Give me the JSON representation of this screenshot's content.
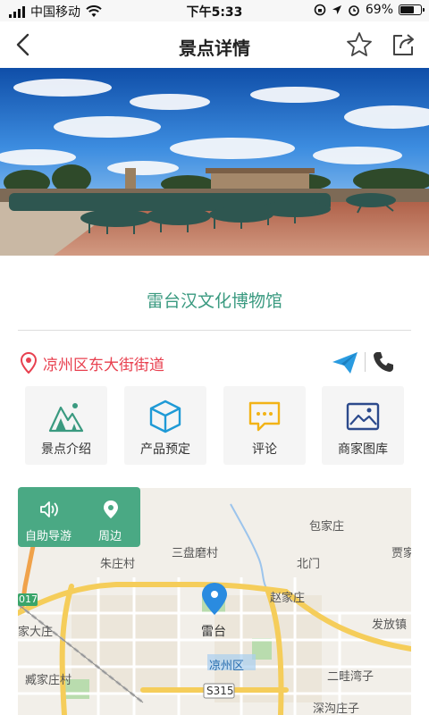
{
  "status_bar": {
    "carrier": "中国移动",
    "time": "下午5:33",
    "battery": "69%",
    "battery_level": 0.69
  },
  "nav": {
    "title": "景点详情"
  },
  "hero": {
    "icon": "hero-photo"
  },
  "place": {
    "name": "雷台汉文化博物馆",
    "address": "凉州区东大街街道"
  },
  "features": [
    {
      "label": "景点介绍",
      "icon": "mountain-icon",
      "color": "#3a9a80"
    },
    {
      "label": "产品预定",
      "icon": "cube-icon",
      "color": "#1f9ad6"
    },
    {
      "label": "评论",
      "icon": "chat-icon",
      "color": "#f2b316"
    },
    {
      "label": "商家图库",
      "icon": "picture-icon",
      "color": "#2c4a8c"
    }
  ],
  "map_panel": {
    "guide_label": "自助导游",
    "nearby_label": "周边"
  },
  "map_labels": {
    "baojiazhuang": "包家庄",
    "sanpanmocun": "三盘磨村",
    "jia": "贾家",
    "zhuzhuangcun": "朱庄村",
    "beimen": "北门",
    "zhaojiazhuang": "赵家庄",
    "fafangzhen": "发放镇",
    "leitai": "雷台",
    "jiadazhuang": "家大庄",
    "liangzhouqu": "凉州区",
    "erwawanzi": "二畦湾子",
    "zangjiazhuangcun": "臧家庄村",
    "s315": "S315",
    "shengouzhuangzi": "深沟庄子",
    "road_017": "017"
  },
  "colors": {
    "accent": "#3a9a80",
    "address_red": "#e8404f",
    "map_green": "#4aa984"
  }
}
